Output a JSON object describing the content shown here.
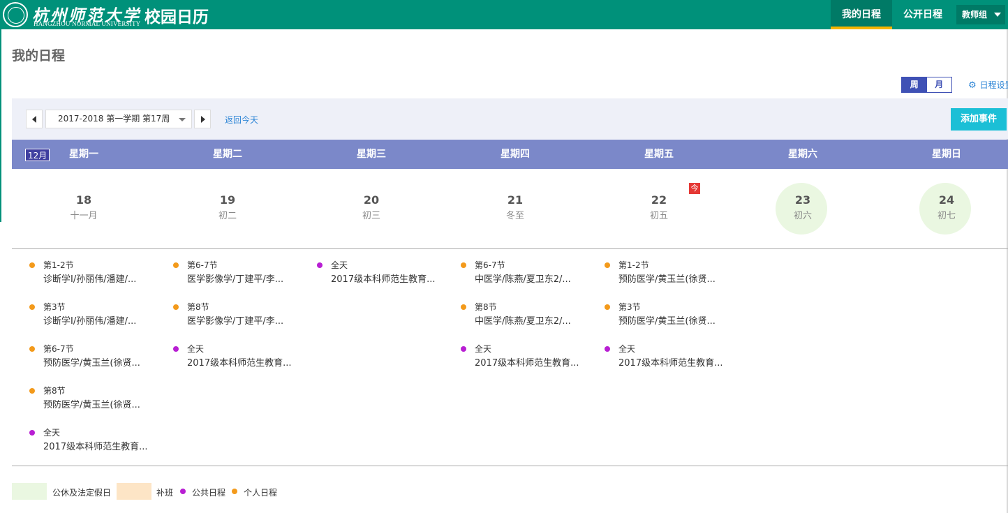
{
  "header": {
    "logo_cn": "杭州师范大学",
    "logo_en": "HANGZHOU NORMAL UNIVERSITY",
    "app_title": "校园日历",
    "tabs": [
      {
        "label": "我的日程",
        "active": true
      },
      {
        "label": "公开日程",
        "active": false
      }
    ],
    "group_dropdown": "教师组"
  },
  "page": {
    "title": "我的日程",
    "view_week": "周",
    "view_month": "月",
    "settings_label": "日程设置"
  },
  "toolbar": {
    "term": "2017-2018 第一学期 第17周",
    "back_today": "返回今天",
    "add_event": "添加事件"
  },
  "calendar": {
    "month_badge": "12月",
    "weekdays": [
      "星期一",
      "星期二",
      "星期三",
      "星期四",
      "星期五",
      "星期六",
      "星期日"
    ],
    "today_tag": "今",
    "days": [
      {
        "date": "18",
        "lunar": "十一月",
        "holiday": false
      },
      {
        "date": "19",
        "lunar": "初二",
        "holiday": false
      },
      {
        "date": "20",
        "lunar": "初三",
        "holiday": false
      },
      {
        "date": "21",
        "lunar": "冬至",
        "holiday": false
      },
      {
        "date": "22",
        "lunar": "初五",
        "holiday": false,
        "today": true
      },
      {
        "date": "23",
        "lunar": "初六",
        "holiday": true
      },
      {
        "date": "24",
        "lunar": "初七",
        "holiday": true
      }
    ],
    "events": [
      [
        {
          "type": "personal",
          "time": "第1-2节",
          "title": "诊断学Ⅰ/孙丽伟/潘建/..."
        },
        {
          "type": "personal",
          "time": "第3节",
          "title": "诊断学Ⅰ/孙丽伟/潘建/..."
        },
        {
          "type": "personal",
          "time": "第6-7节",
          "title": "预防医学/黄玉兰(徐贤..."
        },
        {
          "type": "personal",
          "time": "第8节",
          "title": "预防医学/黄玉兰(徐贤..."
        },
        {
          "type": "public",
          "time": "全天",
          "title": "2017级本科师范生教育..."
        }
      ],
      [
        {
          "type": "personal",
          "time": "第6-7节",
          "title": "医学影像学/丁建平/李..."
        },
        {
          "type": "personal",
          "time": "第8节",
          "title": "医学影像学/丁建平/李..."
        },
        {
          "type": "public",
          "time": "全天",
          "title": "2017级本科师范生教育..."
        }
      ],
      [
        {
          "type": "public",
          "time": "全天",
          "title": "2017级本科师范生教育..."
        }
      ],
      [
        {
          "type": "personal",
          "time": "第6-7节",
          "title": "中医学/陈燕/夏卫东2/..."
        },
        {
          "type": "personal",
          "time": "第8节",
          "title": "中医学/陈燕/夏卫东2/..."
        },
        {
          "type": "public",
          "time": "全天",
          "title": "2017级本科师范生教育..."
        }
      ],
      [
        {
          "type": "personal",
          "time": "第1-2节",
          "title": "预防医学/黄玉兰(徐贤..."
        },
        {
          "type": "personal",
          "time": "第3节",
          "title": "预防医学/黄玉兰(徐贤..."
        },
        {
          "type": "public",
          "time": "全天",
          "title": "2017级本科师范生教育..."
        }
      ],
      [],
      []
    ]
  },
  "legend": {
    "holiday": "公休及法定假日",
    "makeup": "补班",
    "public": "公共日程",
    "personal": "个人日程"
  },
  "colors": {
    "header_bg": "#00917a",
    "accent_underline": "#f5b400",
    "week_header_bg": "#7b88c9",
    "holiday_bg": "#eaf7e1",
    "makeup_bg": "#fde5c6",
    "public_dot": "#b81fd3",
    "personal_dot": "#f39a1b",
    "add_button": "#1bbfd6"
  }
}
